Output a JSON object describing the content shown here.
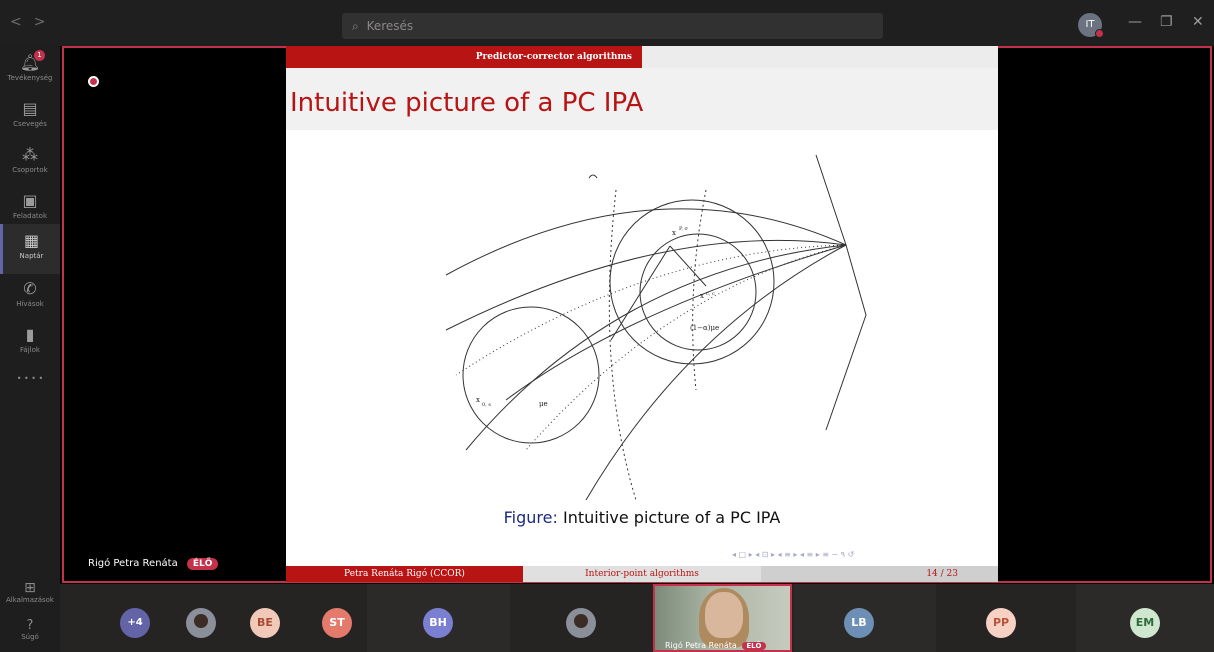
{
  "topbar": {
    "nav_back": "<",
    "nav_forward": ">",
    "search_placeholder": "Keresés",
    "user_initials": "IT",
    "minimize": "—",
    "maximize": "❐",
    "close": "✕"
  },
  "rail": {
    "items": [
      {
        "label": "Tevékenység",
        "badge": "1"
      },
      {
        "label": "Csevegés"
      },
      {
        "label": "Csoportok"
      },
      {
        "label": "Feladatok"
      },
      {
        "label": "Naptár"
      },
      {
        "label": "Hívások"
      },
      {
        "label": "Fájlok"
      }
    ],
    "more": "• • • •",
    "apps": "Alkalmazások",
    "help": "Súgó"
  },
  "stage": {
    "presenter_name": "Rigó Petra Renáta",
    "live_label": "ÉLŐ"
  },
  "slide": {
    "section": "Predictor-corrector algorithms",
    "title": "Intuitive picture of a PC IPA",
    "caption_prefix": "Figure:",
    "caption_text": "Intuitive picture of a PC IPA",
    "nav_symbols": "◂ □ ▸ ◂ ⊡ ▸ ◂ ≡ ▸ ◂ ≡ ▸   ≡   ∽ ۹ ↺",
    "footer_author": "Petra Renáta Rigó (CCOR)",
    "footer_title": "Interior-point algorithms",
    "footer_page": "14 / 23",
    "figure_labels": {
      "x_top": "x",
      "x_top_sup": "P, σ",
      "x_mid": "x",
      "x_mid_sup": "c, c",
      "one_minus_alpha": "(1−α)μe",
      "mu_e": "μe",
      "x_left": "x",
      "x_left_sup": "0, s"
    }
  },
  "participants": {
    "overflow": "+4",
    "avatars": [
      {
        "initials": "BE",
        "color": "#f1c9b9",
        "text_color": "#a94b34"
      },
      {
        "initials": "ST",
        "color": "#e47a6c",
        "text_color": "#ffffff"
      },
      {
        "initials": "BH",
        "color": "#7b7fd1",
        "text_color": "#ffffff"
      },
      {
        "initials": "LB",
        "color": "#6e8fb5",
        "text_color": "#ffffff"
      },
      {
        "initials": "PP",
        "color": "#f6d1c4",
        "text_color": "#b5553b"
      },
      {
        "initials": "EM",
        "color": "#cfe6cf",
        "text_color": "#2f6b3a"
      }
    ],
    "video_name": "Rigó Petra Renáta",
    "video_live": "ÉLŐ"
  }
}
